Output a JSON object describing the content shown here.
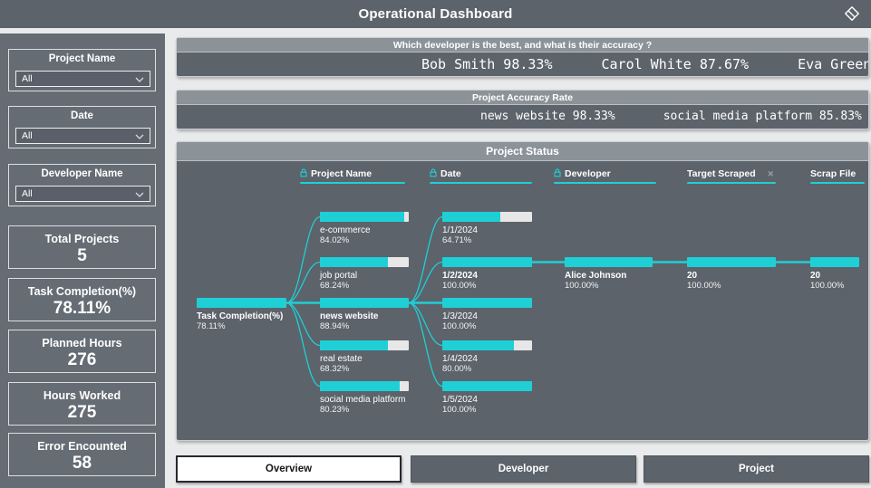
{
  "app": {
    "title": "Operational Dashboard",
    "header_icon": "tag-icon"
  },
  "colors": {
    "accent": "#1ed0d6",
    "panel": "#5c636b",
    "panel_header": "#8b9399",
    "sidebar": "#656c74",
    "page_bg": "#e9eaeb",
    "bar_remainder": "#e7e7e7",
    "active_tab_bg": "#ffffff",
    "remove_icon": "#9aa0a6"
  },
  "sidebar": {
    "slicers": [
      {
        "label": "Project Name",
        "value": "All"
      },
      {
        "label": "Date",
        "value": "All"
      },
      {
        "label": "Developer Name",
        "value": "All"
      }
    ],
    "kpis": [
      {
        "label": "Total Projects",
        "value": "5"
      },
      {
        "label": "Task Completion(%)",
        "value": "78.11%"
      },
      {
        "label": "Planned Hours",
        "value": "276"
      },
      {
        "label": "Hours Worked",
        "value": "275"
      },
      {
        "label": "Error Encounted",
        "value": "58"
      }
    ]
  },
  "tickers": [
    {
      "title": "Which developer is the best, and what is their accuracy ?",
      "items": [
        "Bob Smith 98.33%",
        "Carol White 87.67%",
        "Eva Green"
      ]
    },
    {
      "title": "Project Accuracy Rate",
      "items": [
        "news website 98.33%",
        "social media platform 85.83%"
      ]
    }
  ],
  "project_status": {
    "title": "Project Status",
    "columns": [
      {
        "label": "Project Name",
        "locked": true,
        "removable": false
      },
      {
        "label": "Date",
        "locked": true,
        "removable": false
      },
      {
        "label": "Developer",
        "locked": true,
        "removable": false
      },
      {
        "label": "Target Scraped",
        "locked": false,
        "removable": true
      },
      {
        "label": "Scrap File",
        "locked": false,
        "removable": false
      }
    ],
    "chart_data": {
      "type": "decomposition-tree",
      "metric": "Task Completion(%)",
      "levels": [
        "root",
        "Project Name",
        "Date",
        "Developer",
        "Target Scraped",
        "Scrap File"
      ],
      "nodes": [
        {
          "id": "root",
          "level": "root",
          "row": 2,
          "label": "Task Completion(%)",
          "value": "78.11%",
          "fill": 1.0,
          "emphasis": true
        },
        {
          "id": "p1",
          "level": "Project Name",
          "row": 0,
          "label": "e-commerce",
          "value": "84.02%",
          "fill": 0.945,
          "emphasis": false
        },
        {
          "id": "p2",
          "level": "Project Name",
          "row": 1,
          "label": "job portal",
          "value": "68.24%",
          "fill": 0.767,
          "emphasis": false
        },
        {
          "id": "p3",
          "level": "Project Name",
          "row": 2,
          "label": "news website",
          "value": "88.94%",
          "fill": 1.0,
          "emphasis": true
        },
        {
          "id": "p4",
          "level": "Project Name",
          "row": 3,
          "label": "real estate",
          "value": "68.32%",
          "fill": 0.768,
          "emphasis": false
        },
        {
          "id": "p5",
          "level": "Project Name",
          "row": 4,
          "label": "social media platform",
          "value": "80.23%",
          "fill": 0.902,
          "emphasis": false
        },
        {
          "id": "d1",
          "level": "Date",
          "row": 0,
          "label": "1/1/2024",
          "value": "64.71%",
          "fill": 0.647,
          "emphasis": false
        },
        {
          "id": "d2",
          "level": "Date",
          "row": 1,
          "label": "1/2/2024",
          "value": "100.00%",
          "fill": 1.0,
          "emphasis": true
        },
        {
          "id": "d3",
          "level": "Date",
          "row": 2,
          "label": "1/3/2024",
          "value": "100.00%",
          "fill": 1.0,
          "emphasis": false
        },
        {
          "id": "d4",
          "level": "Date",
          "row": 3,
          "label": "1/4/2024",
          "value": "80.00%",
          "fill": 0.8,
          "emphasis": false
        },
        {
          "id": "d5",
          "level": "Date",
          "row": 4,
          "label": "1/5/2024",
          "value": "100.00%",
          "fill": 1.0,
          "emphasis": false
        },
        {
          "id": "dev1",
          "level": "Developer",
          "row": 1,
          "label": "Alice Johnson",
          "value": "100.00%",
          "fill": 1.0,
          "emphasis": true
        },
        {
          "id": "t1",
          "level": "Target Scraped",
          "row": 1,
          "label": "20",
          "value": "100.00%",
          "fill": 1.0,
          "emphasis": true
        },
        {
          "id": "s1",
          "level": "Scrap File",
          "row": 1,
          "label": "20",
          "value": "100.00%",
          "fill": 1.0,
          "emphasis": true
        }
      ],
      "edges": [
        [
          "root",
          "p1"
        ],
        [
          "root",
          "p2"
        ],
        [
          "root",
          "p3"
        ],
        [
          "root",
          "p4"
        ],
        [
          "root",
          "p5"
        ],
        [
          "p3",
          "d1"
        ],
        [
          "p3",
          "d2"
        ],
        [
          "p3",
          "d3"
        ],
        [
          "p3",
          "d4"
        ],
        [
          "p3",
          "d5"
        ],
        [
          "d2",
          "dev1"
        ],
        [
          "dev1",
          "t1"
        ],
        [
          "t1",
          "s1"
        ]
      ]
    }
  },
  "tabs": [
    {
      "label": "Overview",
      "active": true
    },
    {
      "label": "Developer",
      "active": false
    },
    {
      "label": "Project",
      "active": false
    }
  ]
}
